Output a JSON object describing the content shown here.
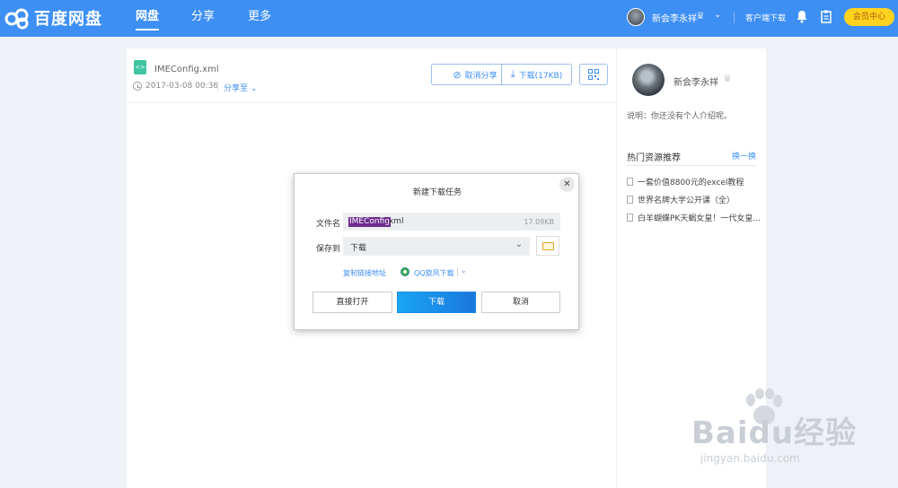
{
  "header": {
    "logo_text": "百度网盘",
    "nav": [
      "网盘",
      "分享",
      "更多"
    ],
    "active_nav": "网盘",
    "username": "新会李永祥",
    "client_download": "客户端下载",
    "vip_label": "会员中心",
    "icons": [
      "baidu-cloud-logo-icon",
      "crown-icon",
      "chevron-down-icon",
      "bell-icon",
      "clipboard-icon"
    ],
    "brand_color": "#3d8ff4",
    "vip_color": "#ffd21f"
  },
  "file": {
    "name": "IMEConfig.xml",
    "date": "2017-03-08 00:36",
    "share_to": "分享至",
    "cancel_share": "取消分享",
    "download_label": "下载(17KB)",
    "qr_icon": "qrcode-icon"
  },
  "sidebar": {
    "username": "新会李永祥",
    "description": "说明：你还没有个人介绍呢。",
    "hot_title": "热门资源推荐",
    "hot_change": "换一换",
    "hot_items": [
      "一套价值8800元的excel教程",
      "世界名牌大学公开课（全）",
      "白羊蝴蝶PK天蝎女皇！一代女皇..."
    ]
  },
  "dialog": {
    "title": "新建下载任务",
    "filename_label": "文件名",
    "filename_selected": "IMEConfig",
    "filename_rest": ".xml",
    "filesize": "17.09KB",
    "saveto_label": "保存到",
    "saveto_value": "下载",
    "copy_link": "复制链接地址",
    "qq_download": "QQ旋风下载",
    "btn_open": "直接打开",
    "btn_download": "下载",
    "btn_cancel": "取消"
  },
  "watermark": {
    "brand": "Baidu经验",
    "url": "jingyan.baidu.com"
  }
}
